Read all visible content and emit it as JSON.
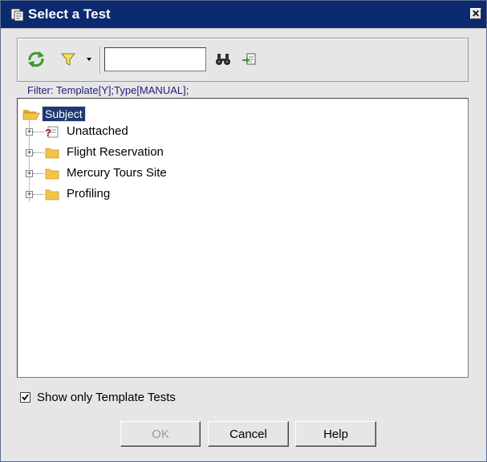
{
  "window": {
    "title": "Select a Test",
    "close_glyph": "✕",
    "title_icon": "test-dialog-icon"
  },
  "toolbar": {
    "refresh_icon": "refresh-icon",
    "filter_icon": "filter-funnel-icon",
    "search_value": "",
    "find_icon": "binoculars-icon",
    "goto_icon": "go-to-test-icon"
  },
  "filter": {
    "text": "Filter: Template[Y];Type[MANUAL];"
  },
  "tree": {
    "root_label": "Subject",
    "nodes": [
      {
        "label": "Unattached",
        "icon": "unattached-question-folder-icon",
        "expander": "+"
      },
      {
        "label": "Flight Reservation",
        "icon": "folder-icon",
        "expander": "+"
      },
      {
        "label": "Mercury Tours Site",
        "icon": "folder-icon",
        "expander": "+"
      },
      {
        "label": "Profiling",
        "icon": "folder-icon",
        "expander": "+"
      }
    ]
  },
  "options": {
    "show_template_label": "Show only Template Tests",
    "show_template_checked": true
  },
  "buttons": {
    "ok": "OK",
    "cancel": "Cancel",
    "help": "Help"
  },
  "colors": {
    "title_bar": "#0b2a6f",
    "selection": "#1f3a73",
    "folder": "#f3c34a",
    "dialog_bg": "#e6e6e6"
  }
}
